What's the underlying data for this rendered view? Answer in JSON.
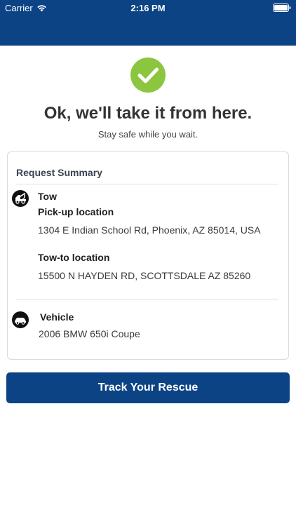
{
  "status_bar": {
    "carrier": "Carrier",
    "time": "2:16 PM",
    "icons": [
      "wifi-icon",
      "battery-icon"
    ]
  },
  "header": {
    "color": "#0c4385"
  },
  "confirmation": {
    "icon": "checkmark-icon",
    "icon_color": "#8cc63f",
    "headline": "Ok, we'll take it from here.",
    "subline": "Stay safe while you wait."
  },
  "summary": {
    "title": "Request Summary",
    "service": {
      "icon": "tow-truck-icon",
      "label": "Tow",
      "pickup_label": "Pick-up location",
      "pickup_value": "1304 E Indian School Rd, Phoenix, AZ 85014, USA",
      "towto_label": "Tow-to location",
      "towto_value": "15500 N HAYDEN RD, SCOTTSDALE AZ 85260"
    },
    "vehicle": {
      "icon": "car-icon",
      "label": "Vehicle",
      "value": "2006 BMW 650i Coupe"
    }
  },
  "actions": {
    "track_label": "Track Your Rescue",
    "accent_color": "#0c4385"
  }
}
